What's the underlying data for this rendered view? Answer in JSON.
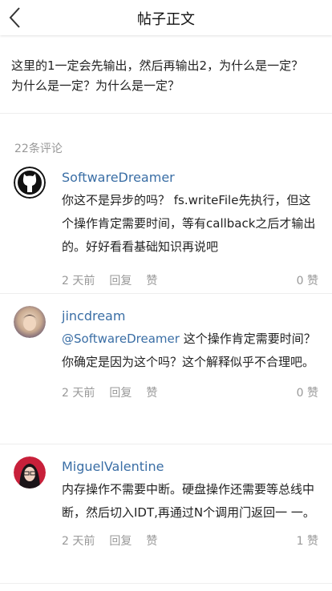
{
  "header": {
    "title": "帖子正文"
  },
  "post": {
    "text": "这里的1一定会先输出，然后再输出2，为什么是一定？ 为什么是一定？为什么是一定？"
  },
  "comments_count": "22条评论",
  "comments": [
    {
      "author": "SoftwareDreamer",
      "text": "你这不是异步的吗？ fs.writeFile先执行，但这个操作肯定需要时间，等有callback之后才输出的。好好看看基础知识再说吧",
      "time": "2 天前",
      "reply": "回复",
      "like": "赞",
      "likes": "0 赞"
    },
    {
      "author": "jincdream",
      "mention": "@SoftwareDreamer",
      "text": " 这个操作肯定需要时间？你确定是因为这个吗？这个解释似乎不合理吧。",
      "time": "2 天前",
      "reply": "回复",
      "like": "赞",
      "likes": "0 赞"
    },
    {
      "author": "MiguelValentine",
      "text": "内存操作不需要中断。硬盘操作还需要等总线中断，然后切入IDT,再通过N个调用门返回一 一。",
      "time": "2 天前",
      "reply": "回复",
      "like": "赞",
      "likes": "1 赞"
    }
  ]
}
